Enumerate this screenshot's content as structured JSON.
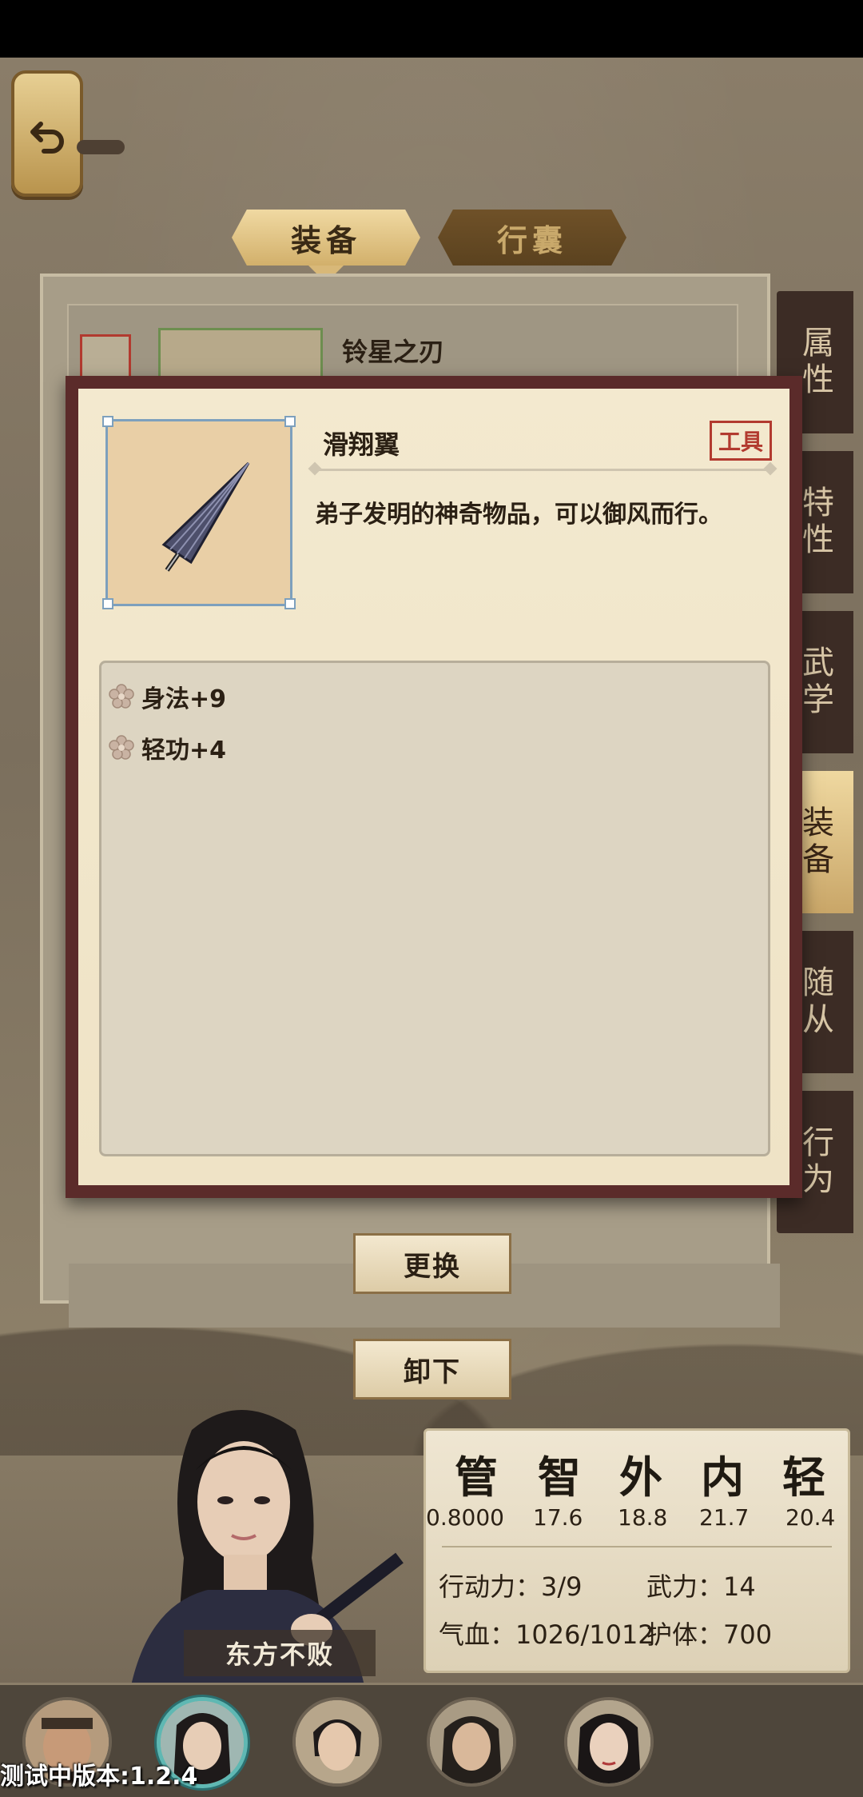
{
  "tabs": {
    "equip": "装备",
    "bag": "行囊"
  },
  "equipped_item": {
    "name": "铃星之刃"
  },
  "side_tabs": [
    "属性",
    "特性",
    "武学",
    "装备",
    "随从",
    "行为"
  ],
  "side_tab_active": 3,
  "buttons": {
    "replace": "更换",
    "unequip": "卸下"
  },
  "item_popup": {
    "name": "滑翔翼",
    "type": "工具",
    "icon": "umbrella-glider-icon",
    "description": "弟子发明的神奇物品，可以御风而行。",
    "attributes": [
      "身法+9",
      "轻功+4"
    ]
  },
  "stats": {
    "headers": [
      "管",
      "智",
      "外",
      "内",
      "轻"
    ],
    "values": [
      "0.8000",
      "17.6",
      "18.8",
      "21.7",
      "20.4"
    ],
    "action_points": "行动力：3/9",
    "force": "武力：14",
    "hp": "气血：1026/1012",
    "shield": "护体：700"
  },
  "character": {
    "name": "东方不败"
  },
  "version": "测试中版本:1.2.4",
  "colors": {
    "frame": "#5b2b2a",
    "badge": "#b23a2f",
    "selected_ring": "#5fb8b3"
  }
}
